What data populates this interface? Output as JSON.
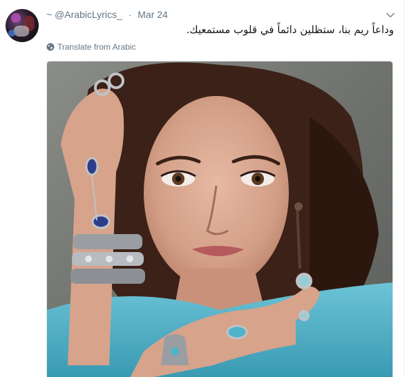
{
  "tweet": {
    "avatar_icon": "user-avatar",
    "handle_prefix": "~",
    "handle": "@ArabicLyrics_",
    "separator": "·",
    "timestamp": "Mar 24",
    "text": "وداعاً ريم بنا، ستظلين دائماً في قلوب مستمعيك.",
    "translate_label": "Translate from Arabic",
    "translate_icon": "globe-icon",
    "menu_icon": "chevron-down-icon",
    "media_description_icon": "photo"
  },
  "colors": {
    "secondary_text": "#657786",
    "primary_text": "#14171a",
    "border": "#e1e8ed",
    "shawl": "#4fb3c9",
    "hair": "#3b2118"
  }
}
